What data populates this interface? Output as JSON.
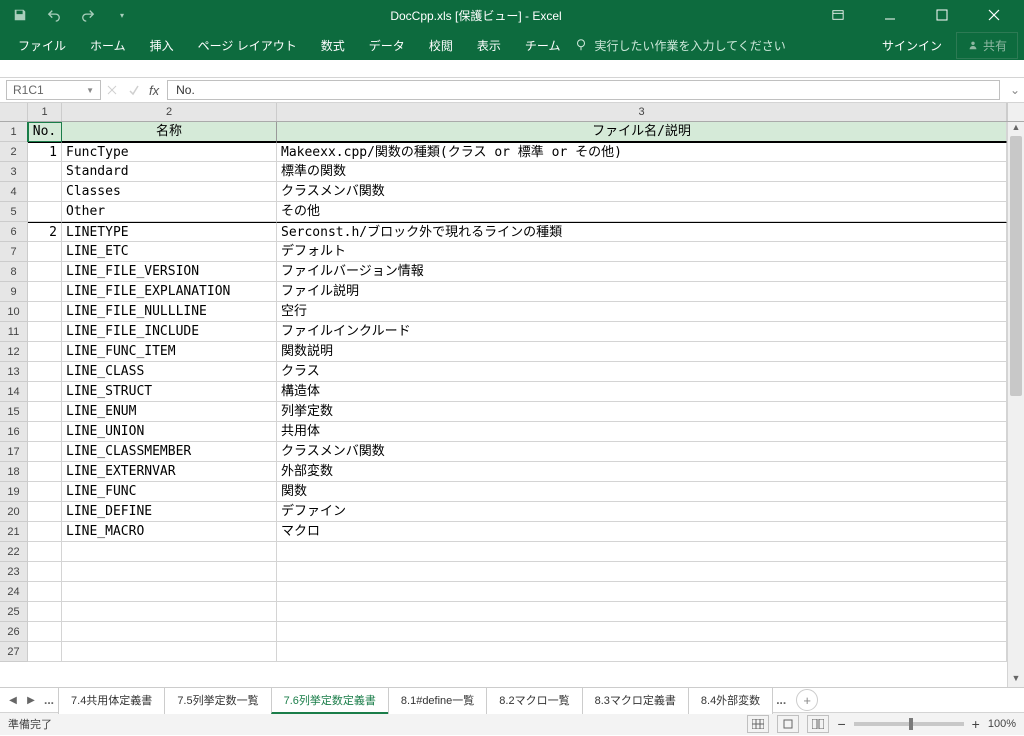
{
  "title": "DocCpp.xls  [保護ビュー] - Excel",
  "ribbon_tabs": [
    "ファイル",
    "ホーム",
    "挿入",
    "ページ レイアウト",
    "数式",
    "データ",
    "校閲",
    "表示",
    "チーム"
  ],
  "tellme": "実行したい作業を入力してください",
  "signin": "サインイン",
  "share": "共有",
  "namebox": "R1C1",
  "formula": "No.",
  "col_headers": [
    "1",
    "2",
    "3"
  ],
  "header_row": {
    "no": "No.",
    "name": "名称",
    "desc": "ファイル名/説明"
  },
  "rows": [
    {
      "r": "1",
      "no": "",
      "name": "",
      "desc": "",
      "is_header": true
    },
    {
      "r": "2",
      "no": "1",
      "name": "FuncType",
      "desc": "Makeexx.cpp/関数の種類(クラス or 標準 or その他)",
      "topline": true
    },
    {
      "r": "3",
      "no": "",
      "name": "Standard",
      "desc": "標準の関数"
    },
    {
      "r": "4",
      "no": "",
      "name": "Classes",
      "desc": "クラスメンバ関数"
    },
    {
      "r": "5",
      "no": "",
      "name": "Other",
      "desc": "その他"
    },
    {
      "r": "6",
      "no": "2",
      "name": "LINETYPE",
      "desc": "Serconst.h/ブロック外で現れるラインの種類",
      "topline": true
    },
    {
      "r": "7",
      "no": "",
      "name": "LINE_ETC",
      "desc": "デフォルト"
    },
    {
      "r": "8",
      "no": "",
      "name": "LINE_FILE_VERSION",
      "desc": "ファイルバージョン情報"
    },
    {
      "r": "9",
      "no": "",
      "name": "LINE_FILE_EXPLANATION",
      "desc": "ファイル説明"
    },
    {
      "r": "10",
      "no": "",
      "name": "LINE_FILE_NULLLINE",
      "desc": "空行"
    },
    {
      "r": "11",
      "no": "",
      "name": "LINE_FILE_INCLUDE",
      "desc": "ファイルインクルード"
    },
    {
      "r": "12",
      "no": "",
      "name": "LINE_FUNC_ITEM",
      "desc": "関数説明"
    },
    {
      "r": "13",
      "no": "",
      "name": "LINE_CLASS",
      "desc": "クラス"
    },
    {
      "r": "14",
      "no": "",
      "name": "LINE_STRUCT",
      "desc": "構造体"
    },
    {
      "r": "15",
      "no": "",
      "name": "LINE_ENUM",
      "desc": "列挙定数"
    },
    {
      "r": "16",
      "no": "",
      "name": "LINE_UNION",
      "desc": "共用体"
    },
    {
      "r": "17",
      "no": "",
      "name": "LINE_CLASSMEMBER",
      "desc": "クラスメンバ関数"
    },
    {
      "r": "18",
      "no": "",
      "name": "LINE_EXTERNVAR",
      "desc": "外部変数"
    },
    {
      "r": "19",
      "no": "",
      "name": "LINE_FUNC",
      "desc": "関数"
    },
    {
      "r": "20",
      "no": "",
      "name": "LINE_DEFINE",
      "desc": "デファイン"
    },
    {
      "r": "21",
      "no": "",
      "name": "LINE_MACRO",
      "desc": "マクロ"
    },
    {
      "r": "22",
      "no": "",
      "name": "",
      "desc": ""
    },
    {
      "r": "23",
      "no": "",
      "name": "",
      "desc": ""
    },
    {
      "r": "24",
      "no": "",
      "name": "",
      "desc": ""
    },
    {
      "r": "25",
      "no": "",
      "name": "",
      "desc": ""
    },
    {
      "r": "26",
      "no": "",
      "name": "",
      "desc": ""
    },
    {
      "r": "27",
      "no": "",
      "name": "",
      "desc": ""
    }
  ],
  "sheets": [
    "7.4共用体定義書",
    "7.5列挙定数一覧",
    "7.6列挙定数定義書",
    "8.1#define一覧",
    "8.2マクロ一覧",
    "8.3マクロ定義書",
    "8.4外部変数"
  ],
  "active_sheet": 2,
  "sheet_trailing": "...",
  "status": "準備完了",
  "zoom": "100%"
}
